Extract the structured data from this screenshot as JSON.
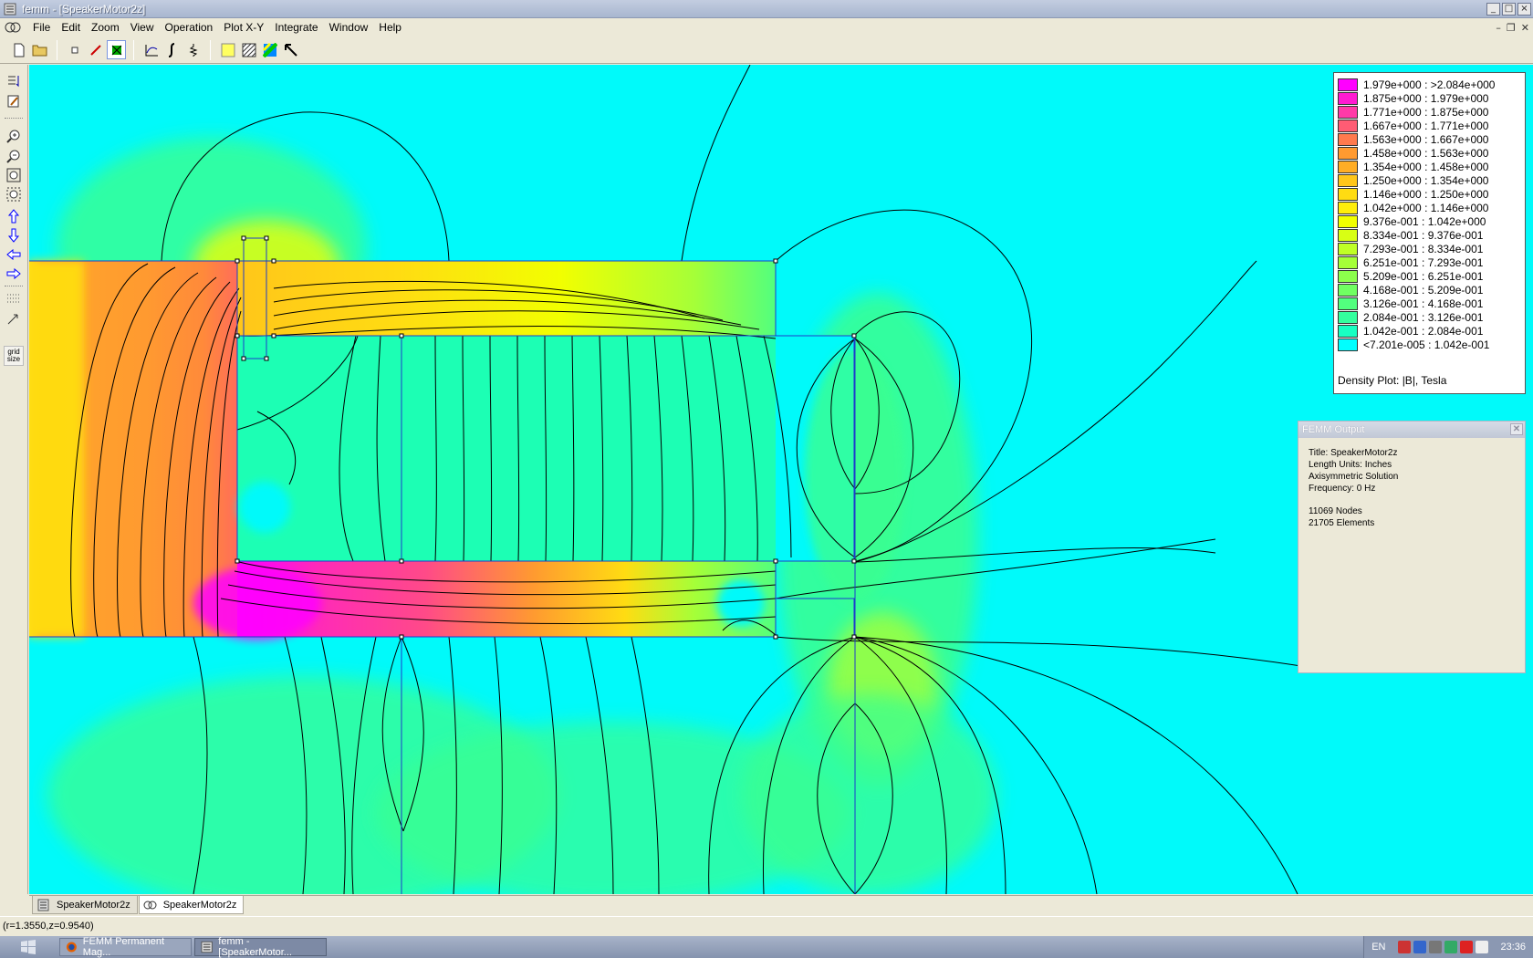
{
  "window": {
    "title": "femm - [SpeakerMotor2z]",
    "icon": "femm-icon"
  },
  "menu": {
    "items": [
      "File",
      "Edit",
      "Zoom",
      "View",
      "Operation",
      "Plot X-Y",
      "Integrate",
      "Window",
      "Help"
    ]
  },
  "toolbar": {
    "icons": [
      "new-document-icon",
      "open-folder-icon",
      "node-icon",
      "segment-icon",
      "block-label-icon",
      "plot-xy-icon",
      "integrate-icon",
      "circuit-icon",
      "density-plot-icon",
      "vector-plot-icon",
      "contour-plot-icon",
      "select-arrow-icon"
    ]
  },
  "left_toolbar": {
    "icons": [
      "edit-icon",
      "pencil-icon",
      "zoom-in-icon",
      "zoom-out-icon",
      "zoom-natural-icon",
      "zoom-window-icon",
      "pan-up-icon",
      "pan-down-icon",
      "pan-left-icon",
      "pan-right-icon",
      "grid-icon",
      "snap-icon"
    ],
    "grid_label": "grid size"
  },
  "legend": {
    "entries": [
      {
        "label": "1.979e+000 : >2.084e+000",
        "color": "#ff00ff"
      },
      {
        "label": "1.875e+000 : 1.979e+000",
        "color": "#ff1ad1"
      },
      {
        "label": "1.771e+000 : 1.875e+000",
        "color": "#ff3aa8"
      },
      {
        "label": "1.667e+000 : 1.771e+000",
        "color": "#ff5c74"
      },
      {
        "label": "1.563e+000 : 1.667e+000",
        "color": "#ff7a4e"
      },
      {
        "label": "1.458e+000 : 1.563e+000",
        "color": "#ff9a30"
      },
      {
        "label": "1.354e+000 : 1.458e+000",
        "color": "#ffad25"
      },
      {
        "label": "1.250e+000 : 1.354e+000",
        "color": "#ffc61a"
      },
      {
        "label": "1.146e+000 : 1.250e+000",
        "color": "#ffdc12"
      },
      {
        "label": "1.042e+000 : 1.146e+000",
        "color": "#ffee0a"
      },
      {
        "label": "9.376e-001 : 1.042e+000",
        "color": "#f2ff00"
      },
      {
        "label": "8.334e-001 : 9.376e-001",
        "color": "#d8ff14"
      },
      {
        "label": "7.293e-001 : 8.334e-001",
        "color": "#bfff26"
      },
      {
        "label": "6.251e-001 : 7.293e-001",
        "color": "#a5ff38"
      },
      {
        "label": "5.209e-001 : 6.251e-001",
        "color": "#8cff4c"
      },
      {
        "label": "4.168e-001 : 5.209e-001",
        "color": "#70ff62"
      },
      {
        "label": "3.126e-001 : 4.168e-001",
        "color": "#52ff7e"
      },
      {
        "label": "2.084e-001 : 3.126e-001",
        "color": "#34ff9e"
      },
      {
        "label": "1.042e-001 : 2.084e-001",
        "color": "#18ffc2"
      },
      {
        "label": "<7.201e-005 : 1.042e-001",
        "color": "#00ffff"
      }
    ],
    "caption": "Density Plot: |B|, Tesla"
  },
  "output": {
    "title": "FEMM Output",
    "lines": [
      "Title: SpeakerMotor2z",
      "Length Units: Inches",
      "Axisymmetric Solution",
      "Frequency: 0 Hz"
    ],
    "stats": [
      "11069 Nodes",
      "21705 Elements"
    ]
  },
  "tabs": [
    "SpeakerMotor2z",
    "SpeakerMotor2z"
  ],
  "status": {
    "coords": "(r=1.3550,z=0.9540)"
  },
  "taskbar": {
    "tasks": [
      "FEMM Permanent Mag...",
      "femm - [SpeakerMotor..."
    ],
    "lang": "EN",
    "clock": "23:36"
  },
  "colors": {
    "background_field": "#00fafa",
    "outline": "#1e3ccc"
  }
}
